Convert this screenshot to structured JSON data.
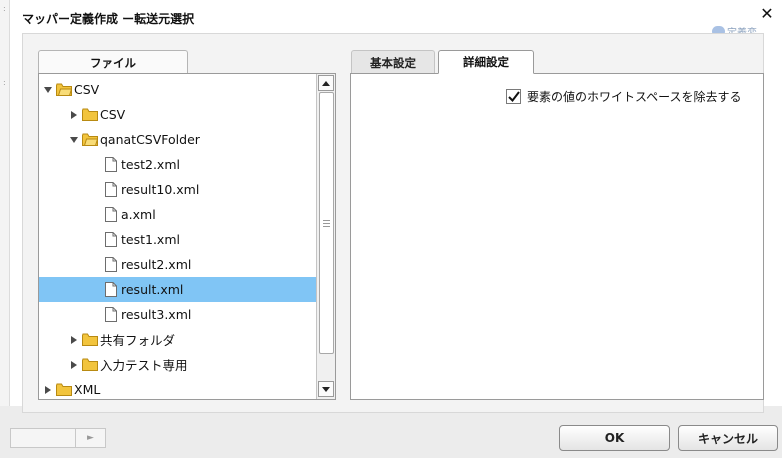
{
  "dialog": {
    "title": "マッパー定義作成 ー転送元選択",
    "close_glyph": "✕"
  },
  "background": {
    "right_hint": "定義変"
  },
  "file_panel": {
    "tab_label": "ファイル",
    "tree": [
      {
        "label": "CSV",
        "type": "folder",
        "expanded": true,
        "level": 0
      },
      {
        "label": "CSV",
        "type": "folder",
        "expanded": false,
        "level": 1
      },
      {
        "label": "qanatCSVFolder",
        "type": "folder",
        "expanded": true,
        "level": 1
      },
      {
        "label": "test2.xml",
        "type": "file",
        "level": 2
      },
      {
        "label": "result10.xml",
        "type": "file",
        "level": 2
      },
      {
        "label": "a.xml",
        "type": "file",
        "level": 2
      },
      {
        "label": "test1.xml",
        "type": "file",
        "level": 2
      },
      {
        "label": "result2.xml",
        "type": "file",
        "level": 2
      },
      {
        "label": "result.xml",
        "type": "file",
        "level": 2,
        "selected": true
      },
      {
        "label": "result3.xml",
        "type": "file",
        "level": 2
      },
      {
        "label": "共有フォルダ",
        "type": "folder",
        "expanded": false,
        "level": 1
      },
      {
        "label": "入力テスト専用",
        "type": "folder",
        "expanded": false,
        "level": 1
      },
      {
        "label": "XML",
        "type": "folder",
        "expanded": false,
        "level": 0
      }
    ]
  },
  "settings_panel": {
    "tabs": [
      {
        "label": "基本設定",
        "active": false
      },
      {
        "label": "詳細設定",
        "active": true
      }
    ],
    "whitespace_option": {
      "label": "要素の値のホワイトスペースを除去する",
      "checked": true
    }
  },
  "buttons": {
    "ok": "OK",
    "cancel": "キャンセル"
  },
  "colors": {
    "selection": "#80c5f5",
    "folder": "#f2c43d"
  }
}
